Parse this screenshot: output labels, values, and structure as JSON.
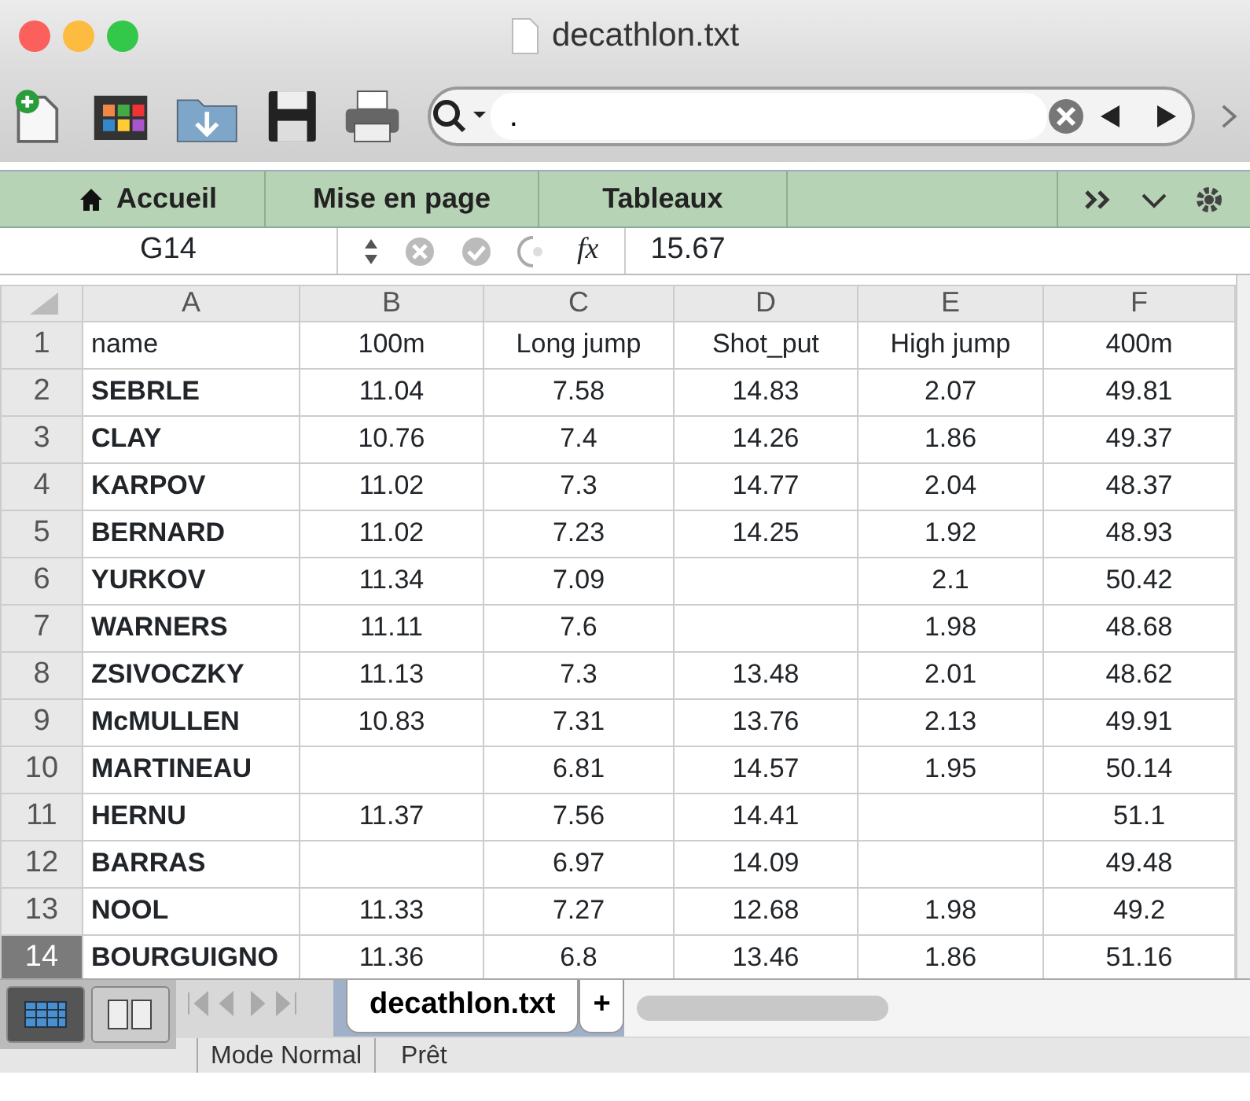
{
  "window": {
    "title": "decathlon.txt"
  },
  "search": {
    "value": "."
  },
  "ribbon_tabs": [
    {
      "label": "Accueil",
      "kind": "home"
    },
    {
      "label": "Mise en page",
      "kind": "plain"
    },
    {
      "label": "Tableaux",
      "kind": "plain"
    }
  ],
  "formula_bar": {
    "cell": "G14",
    "fx": "fx",
    "value": "15.67"
  },
  "columns": [
    "A",
    "B",
    "C",
    "D",
    "E",
    "F"
  ],
  "rows": [
    {
      "number": "1",
      "selected": false,
      "cells": [
        "name",
        "100m",
        "Long jump",
        "Shot_put",
        "High jump",
        "400m"
      ]
    },
    {
      "number": "2",
      "selected": false,
      "cells": [
        "SEBRLE",
        "11.04",
        "7.58",
        "14.83",
        "2.07",
        "49.81"
      ]
    },
    {
      "number": "3",
      "selected": false,
      "cells": [
        "CLAY",
        "10.76",
        "7.4",
        "14.26",
        "1.86",
        "49.37"
      ]
    },
    {
      "number": "4",
      "selected": false,
      "cells": [
        "KARPOV",
        "11.02",
        "7.3",
        "14.77",
        "2.04",
        "48.37"
      ]
    },
    {
      "number": "5",
      "selected": false,
      "cells": [
        "BERNARD",
        "11.02",
        "7.23",
        "14.25",
        "1.92",
        "48.93"
      ]
    },
    {
      "number": "6",
      "selected": false,
      "cells": [
        "YURKOV",
        "11.34",
        "7.09",
        null,
        "2.1",
        "50.42"
      ]
    },
    {
      "number": "7",
      "selected": false,
      "cells": [
        "WARNERS",
        "11.11",
        "7.6",
        null,
        "1.98",
        "48.68"
      ]
    },
    {
      "number": "8",
      "selected": false,
      "cells": [
        "ZSIVOCZKY",
        "11.13",
        "7.3",
        "13.48",
        "2.01",
        "48.62"
      ]
    },
    {
      "number": "9",
      "selected": false,
      "cells": [
        "McMULLEN",
        "10.83",
        "7.31",
        "13.76",
        "2.13",
        "49.91"
      ]
    },
    {
      "number": "10",
      "selected": false,
      "cells": [
        "MARTINEAU",
        null,
        "6.81",
        "14.57",
        "1.95",
        "50.14"
      ]
    },
    {
      "number": "11",
      "selected": false,
      "cells": [
        "HERNU",
        "11.37",
        "7.56",
        "14.41",
        null,
        "51.1"
      ]
    },
    {
      "number": "12",
      "selected": false,
      "cells": [
        "BARRAS",
        null,
        "6.97",
        "14.09",
        null,
        "49.48"
      ]
    },
    {
      "number": "13",
      "selected": false,
      "cells": [
        "NOOL",
        "11.33",
        "7.27",
        "12.68",
        "1.98",
        "49.2"
      ]
    },
    {
      "number": "14",
      "selected": true,
      "cells": [
        "BOURGUIGNO",
        "11.36",
        "6.8",
        "13.46",
        "1.86",
        "51.16"
      ]
    }
  ],
  "views": [
    {
      "kind": "normal",
      "selected": true
    },
    {
      "kind": "layout",
      "selected": false
    }
  ],
  "sheet_tabs": [
    {
      "label": "decathlon.txt",
      "selected": true
    }
  ],
  "add_sheet": "+",
  "status_bar": {
    "mode": "Mode Normal",
    "state": "Prêt"
  }
}
